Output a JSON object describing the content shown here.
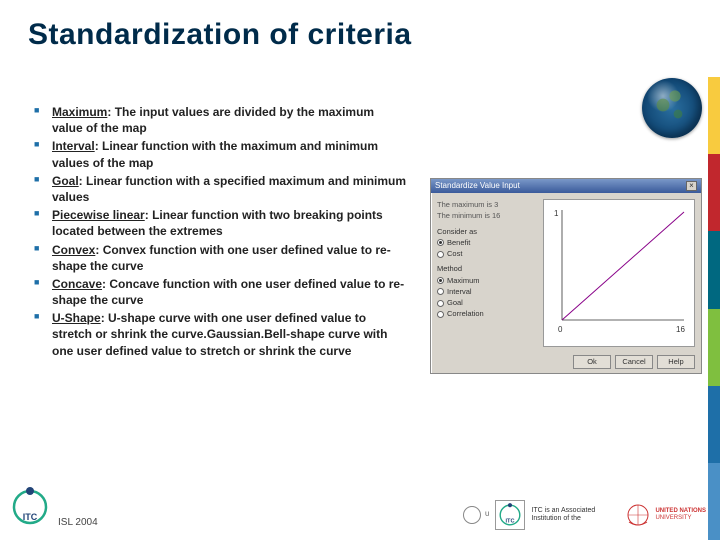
{
  "title": "Standardization of criteria",
  "bullets": [
    {
      "label": "Maximum",
      "text": ": The input values are divided by the maximum value of the map"
    },
    {
      "label": "Interval",
      "text": ": Linear function with the maximum and minimum values of the map"
    },
    {
      "label": "Goal",
      "text": ": Linear function with a specified maximum and minimum values"
    },
    {
      "label": "Piecewise linear",
      "text": ": Linear function with two breaking points located between the extremes"
    },
    {
      "label": "Convex",
      "text": ": Convex function with one user defined value to re-shape the curve"
    },
    {
      "label": "Concave",
      "text": ": Concave function with one user defined value to re-shape the curve"
    },
    {
      "label": "U-Shape",
      "text": ": U-shape curve with one user defined value to stretch or shrink the curve.Gaussian.Bell-shape curve with one user defined value to stretch or shrink the curve"
    }
  ],
  "dialog": {
    "title": "Standardize Value Input",
    "max_line": "The maximum is 3",
    "min_line": "The minimum is 16",
    "consider_label": "Consider as",
    "radios1": {
      "a": {
        "sel": true,
        "label": "Benefit"
      },
      "b": {
        "sel": false,
        "label": "Cost"
      }
    },
    "method_label": "Method",
    "radios2": [
      {
        "sel": true,
        "label": "Maximum"
      },
      {
        "sel": false,
        "label": "Interval"
      },
      {
        "sel": false,
        "label": "Goal"
      },
      {
        "sel": false,
        "label": "Correlation"
      }
    ],
    "axis_lo": "0",
    "axis_hi": "16",
    "btns": {
      "ok": "Ok",
      "cancel": "Cancel",
      "help": "Help"
    }
  },
  "footer": {
    "note": "ISL 2004",
    "un_sub": "U",
    "un_line1": "UNITED NATIONS",
    "un_line2": "UNIVERSITY",
    "itc_assoc": "ITC is an Associated Institution of the",
    "itc_text": "ITC"
  },
  "chart_data": {
    "type": "line",
    "x": [
      0,
      16
    ],
    "values": [
      0,
      1
    ],
    "xlabel": "",
    "ylabel": "",
    "xlim": [
      0,
      16
    ],
    "ylim": [
      0,
      1
    ],
    "title": ""
  }
}
